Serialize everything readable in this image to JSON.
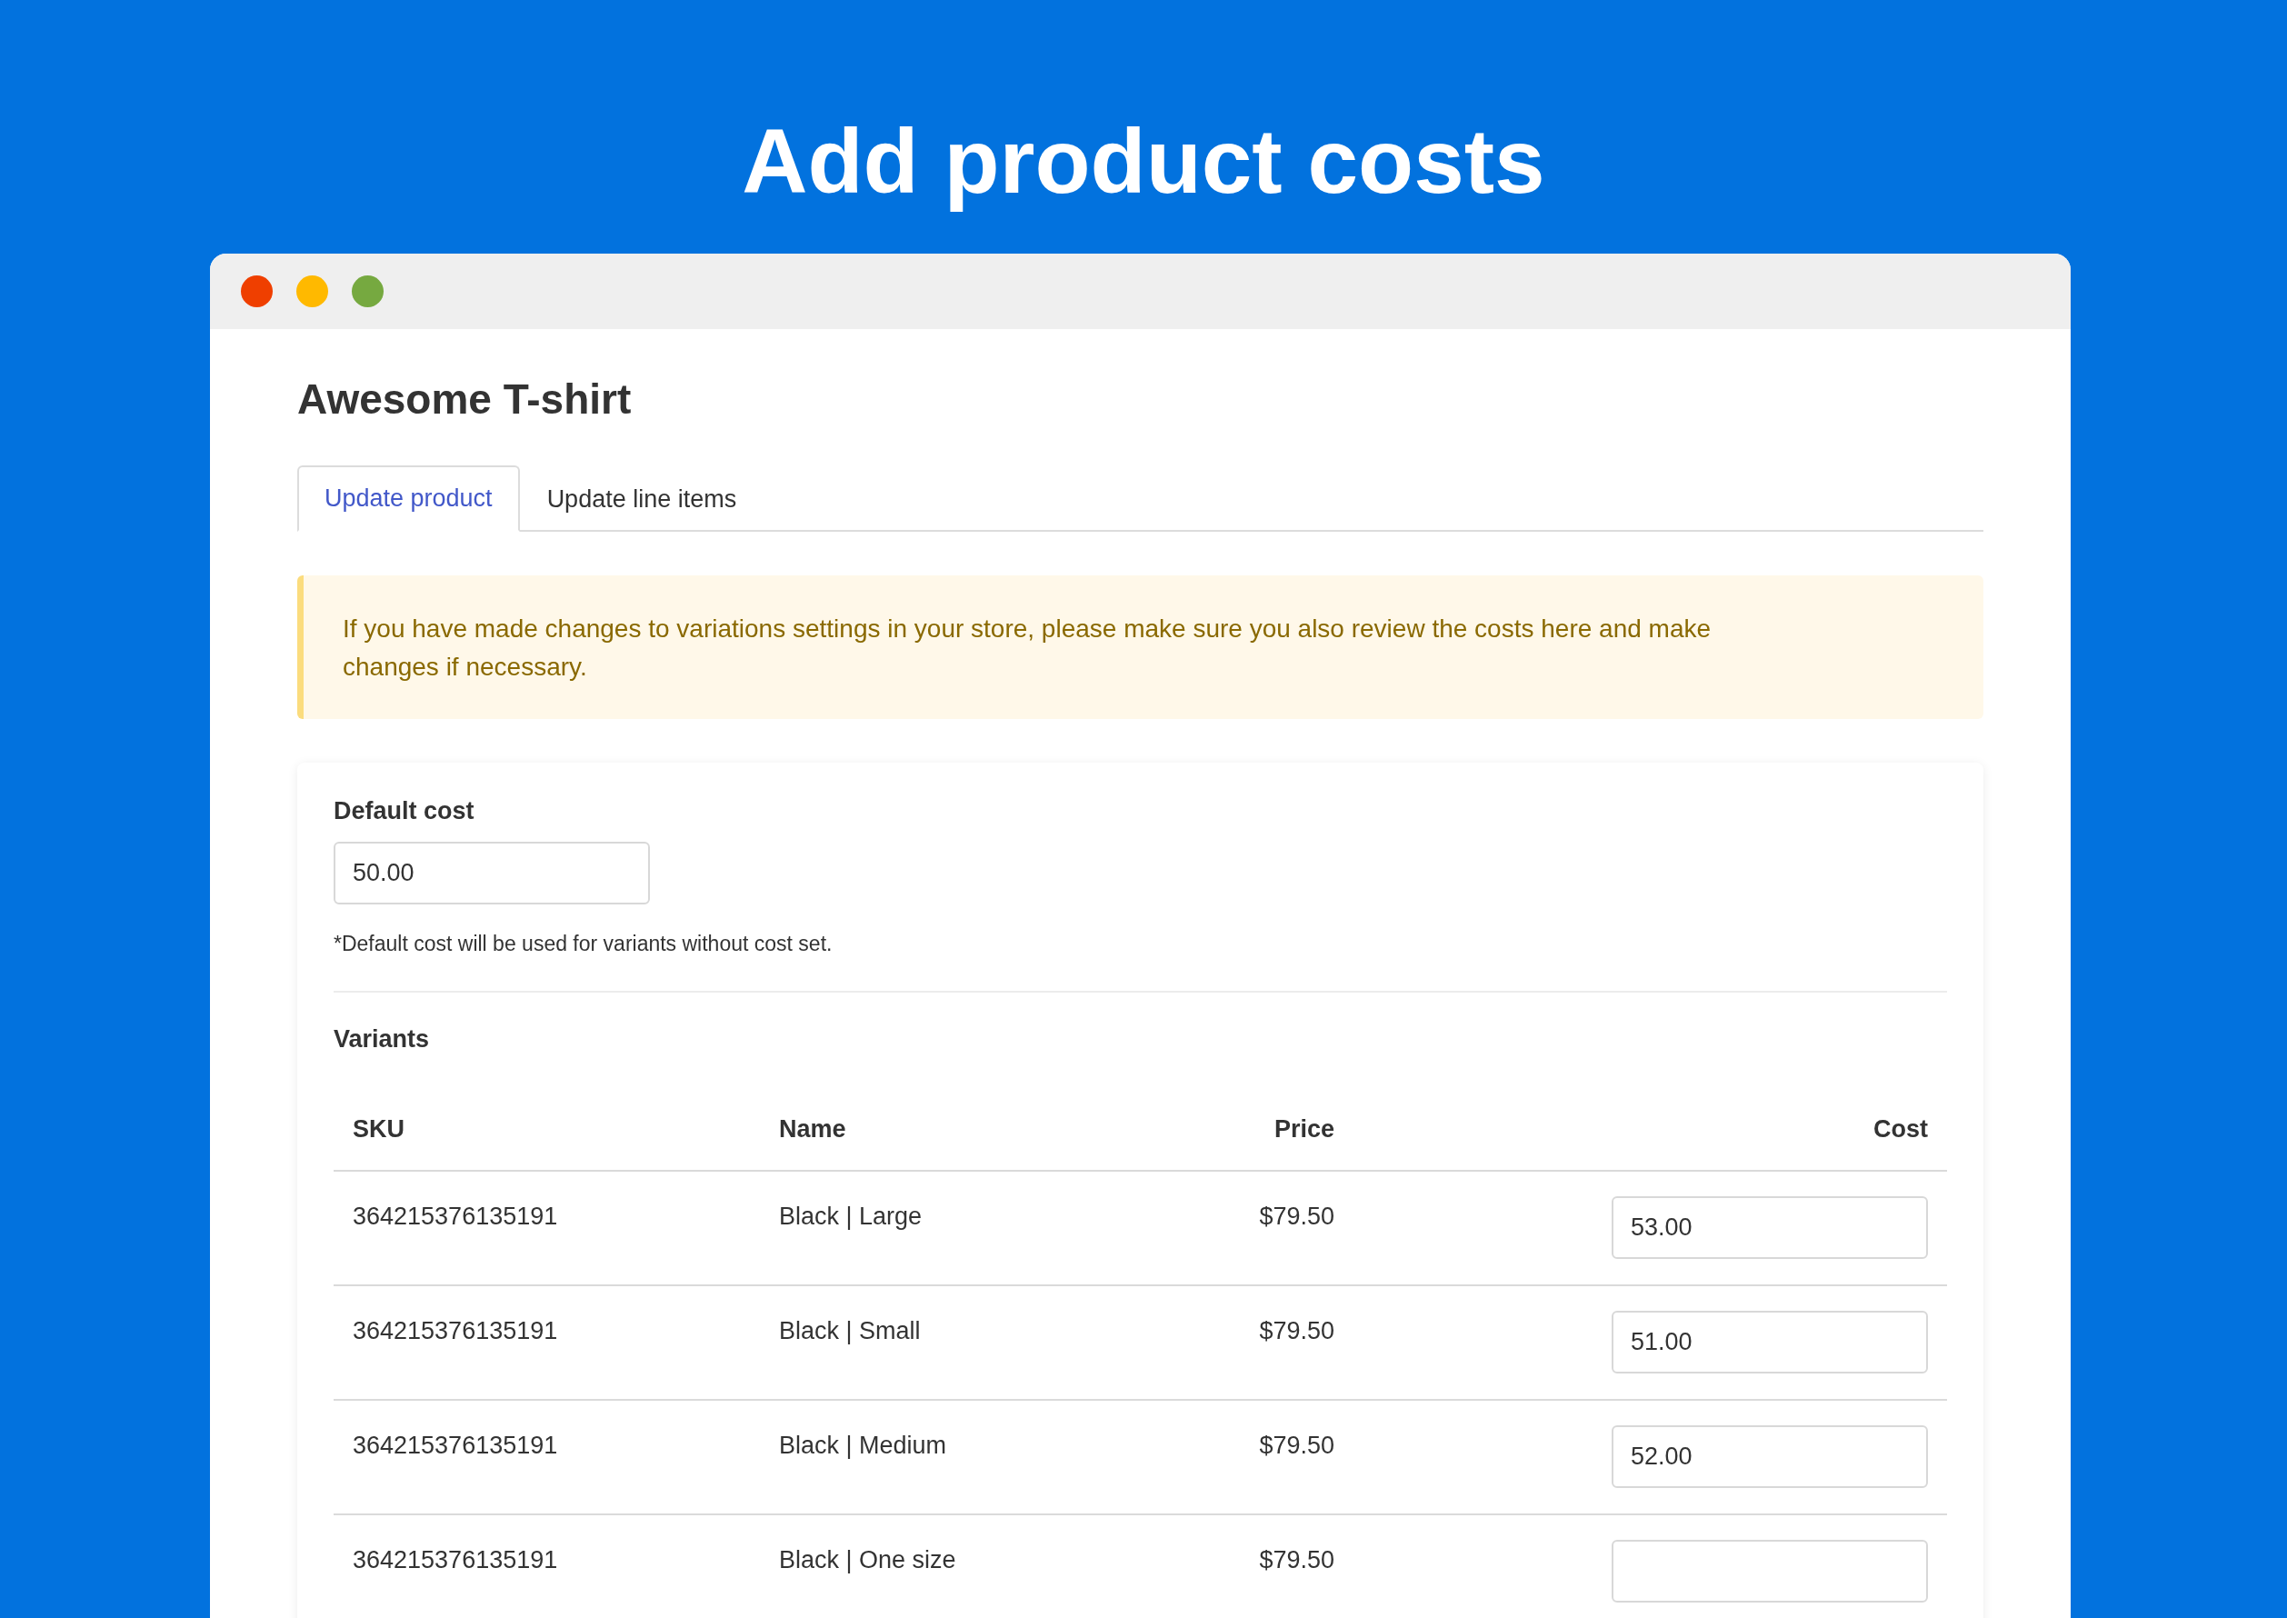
{
  "headline": "Add product costs",
  "window": {
    "traffic_lights": [
      {
        "color": "#ef3f00"
      },
      {
        "color": "#ffb900"
      },
      {
        "color": "#76a940"
      }
    ]
  },
  "title": "Awesome T-shirt",
  "tabs": [
    {
      "label": "Update product",
      "selected": true
    },
    {
      "label": "Update line items",
      "selected": false
    }
  ],
  "notice": "If you have made changes to variations settings in your store, please make sure you also review the costs here and make changes if necessary.",
  "default_cost": {
    "label": "Default cost",
    "value": "50.00",
    "hint": "*Default cost will be used for variants without cost set."
  },
  "variants": {
    "title": "Variants",
    "columns": [
      "SKU",
      "Name",
      "Price",
      "Cost"
    ],
    "rows": [
      {
        "sku": "364215376135191",
        "name": "Black | Large",
        "price": "$79.50",
        "cost": "53.00"
      },
      {
        "sku": "364215376135191",
        "name": "Black | Small",
        "price": "$79.50",
        "cost": "51.00"
      },
      {
        "sku": "364215376135191",
        "name": "Black | Medium",
        "price": "$79.50",
        "cost": "52.00"
      },
      {
        "sku": "364215376135191",
        "name": "Black | One size",
        "price": "$79.50"
      }
    ]
  }
}
